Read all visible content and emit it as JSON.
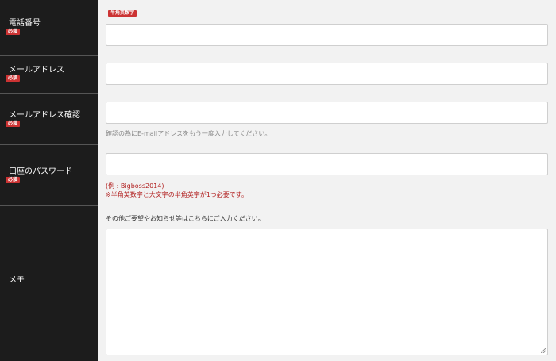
{
  "required_badge": "必須",
  "fields": {
    "phone": {
      "label": "電話番号",
      "tag": "半角英数字"
    },
    "email": {
      "label": "メールアドレス"
    },
    "email_confirm": {
      "label": "メールアドレス確認",
      "hint": "確認の為にE-mailアドレスをもう一度入力してください。"
    },
    "password": {
      "label": "口座のパスワード",
      "example": "(例 : Bigboss2014)",
      "note": "※半角英数字と大文字の半角英字が1つ必要です。"
    },
    "memo": {
      "label": "メモ",
      "hint": "その他ご要望やお知らせ等はこちらにご入力ください。"
    }
  },
  "colors": {
    "label_bg": "#1c1c1c",
    "badge": "#cc3333",
    "field_bg": "#f2f2f2"
  }
}
